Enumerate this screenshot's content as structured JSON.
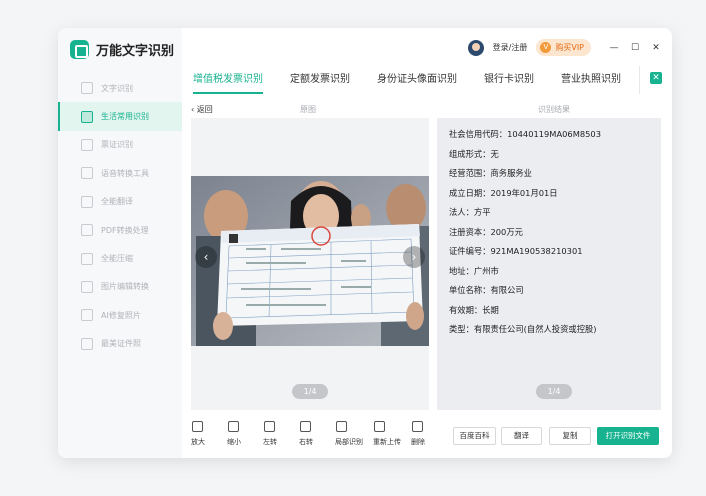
{
  "app": {
    "name": "万能文字识别"
  },
  "titlebar": {
    "login_label": "登录/注册",
    "vip_badge": "V",
    "vip_label": "购买VIP",
    "minimize": "—",
    "maximize": "☐",
    "close": "✕"
  },
  "sidebar": {
    "items": [
      {
        "label": "文字识别",
        "icon": "text-scan-icon"
      },
      {
        "label": "生活常用识别",
        "icon": "life-scan-icon",
        "active": true
      },
      {
        "label": "票证识别",
        "icon": "ticket-icon"
      },
      {
        "label": "语音转换工具",
        "icon": "voice-icon"
      },
      {
        "label": "全能翻译",
        "icon": "translate-icon"
      },
      {
        "label": "PDF转换处理",
        "icon": "pdf-icon"
      },
      {
        "label": "全能压缩",
        "icon": "compress-icon"
      },
      {
        "label": "图片编辑转换",
        "icon": "image-edit-icon"
      },
      {
        "label": "AI修复照片",
        "icon": "ai-repair-icon"
      },
      {
        "label": "最美证件照",
        "icon": "id-photo-icon"
      }
    ]
  },
  "tabs": [
    {
      "label": "增值税发票识别",
      "active": true
    },
    {
      "label": "定额发票识别"
    },
    {
      "label": "身份证头像面识别"
    },
    {
      "label": "银行卡识别"
    },
    {
      "label": "营业执照识别"
    }
  ],
  "main": {
    "back_label": "返回",
    "original_title": "原图",
    "result_title": "识别结果",
    "image_pager": "1/4",
    "result_pager": "1/4",
    "results": [
      "社会信用代码：10440119MA06M8503",
      "组成形式：无",
      "经营范围：商务服务业",
      "成立日期：2019年01月01日",
      "法人：方平",
      "注册资本：200万元",
      "证件编号：921MA190538210301",
      "地址：广州市",
      "单位名称：有限公司",
      "有效期：长期",
      "类型：有限责任公司(自然人投资或控股)"
    ]
  },
  "toolbar": {
    "tools": [
      "放大",
      "缩小",
      "左转",
      "右转",
      "局部识别",
      "重新上传",
      "删除"
    ],
    "baidu_label": "百度百科",
    "translate_label": "翻译",
    "copy_label": "复制",
    "open_label": "打开识别文件"
  },
  "colors": {
    "accent": "#17b28f",
    "vip": "#e46a12"
  }
}
